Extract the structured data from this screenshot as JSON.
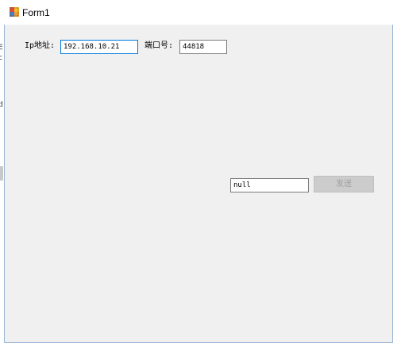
{
  "window": {
    "title": "Form1",
    "icon": "winforms-app-icon"
  },
  "form": {
    "ip_label": "Ip地址:",
    "ip_value": "192.168.10.21",
    "port_label": "端口号:",
    "port_value": "44818",
    "message_value": "null",
    "send_label": "发送"
  },
  "background_edge": {
    "chars": [
      "E",
      "c",
      "d"
    ]
  },
  "colors": {
    "focus_border": "#0078d7",
    "client_bg": "#f0f0f0",
    "disabled_button_bg": "#cccccc"
  }
}
